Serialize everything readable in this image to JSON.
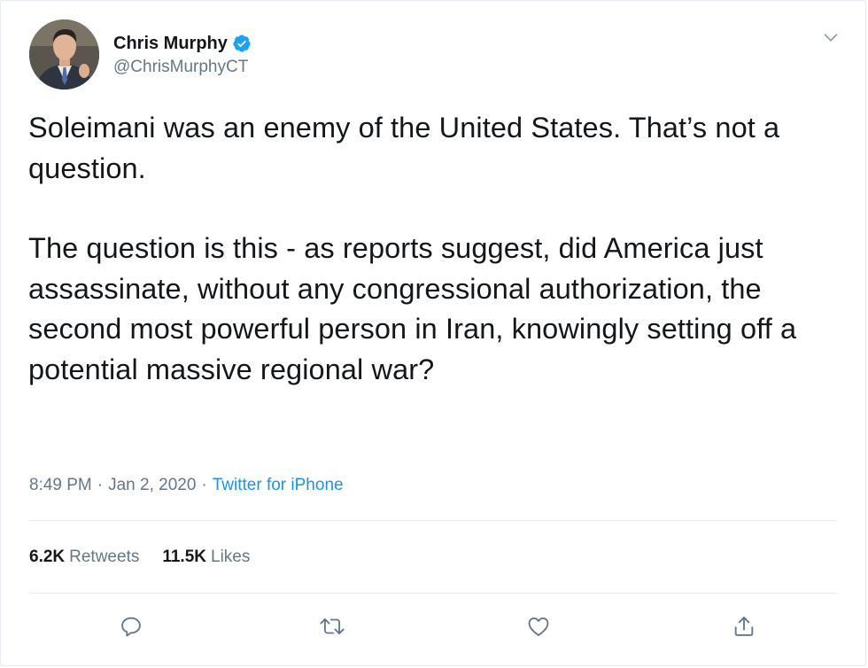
{
  "author": {
    "display_name": "Chris Murphy",
    "handle": "@ChrisMurphyCT",
    "avatar_icon": "avatar-photo",
    "verified_icon": "verified-badge-icon",
    "verified_color": "#1da1f2"
  },
  "tweet": {
    "paragraphs": [
      "Soleimani was an enemy of the United States. That’s not a question.",
      "The question is this - as reports suggest, did America just assassinate, without any congressional authorization, the second most powerful person in Iran, knowingly setting off a potential massive regional war?"
    ]
  },
  "meta": {
    "time": "8:49 PM",
    "separator": "·",
    "date": "Jan 2, 2020",
    "source": "Twitter for iPhone"
  },
  "stats": {
    "retweets_count": "6.2K",
    "retweets_label": "Retweets",
    "likes_count": "11.5K",
    "likes_label": "Likes"
  },
  "actions": {
    "reply_icon": "reply-icon",
    "retweet_icon": "retweet-icon",
    "like_icon": "heart-icon",
    "share_icon": "share-icon"
  },
  "colors": {
    "text": "#14171a",
    "secondary": "#657786",
    "link": "#1b95e0",
    "border": "#e6ecf0"
  }
}
